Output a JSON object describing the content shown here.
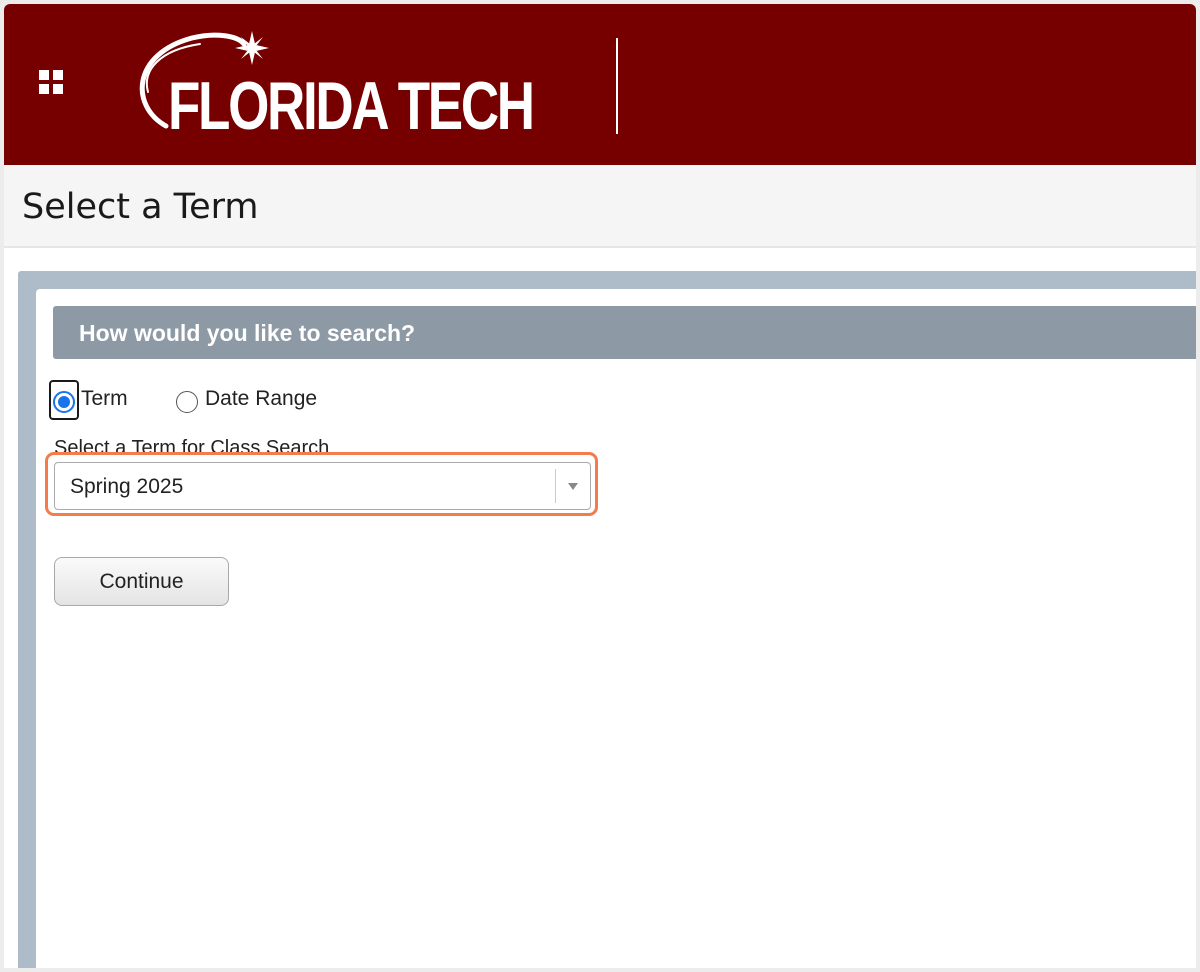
{
  "header": {
    "logo_text": "FLORIDA TECH",
    "brand_color": "#760000",
    "apps_icon": "grid-icon"
  },
  "page": {
    "title": "Select a Term"
  },
  "search": {
    "heading": "How would you like to search?",
    "options": [
      {
        "label": "Term",
        "selected": true
      },
      {
        "label": "Date Range",
        "selected": false
      }
    ],
    "select_label": "Select a Term for Class Search",
    "selected_term": "Spring 2025",
    "continue_label": "Continue",
    "highlight_color": "#f47c4a"
  }
}
